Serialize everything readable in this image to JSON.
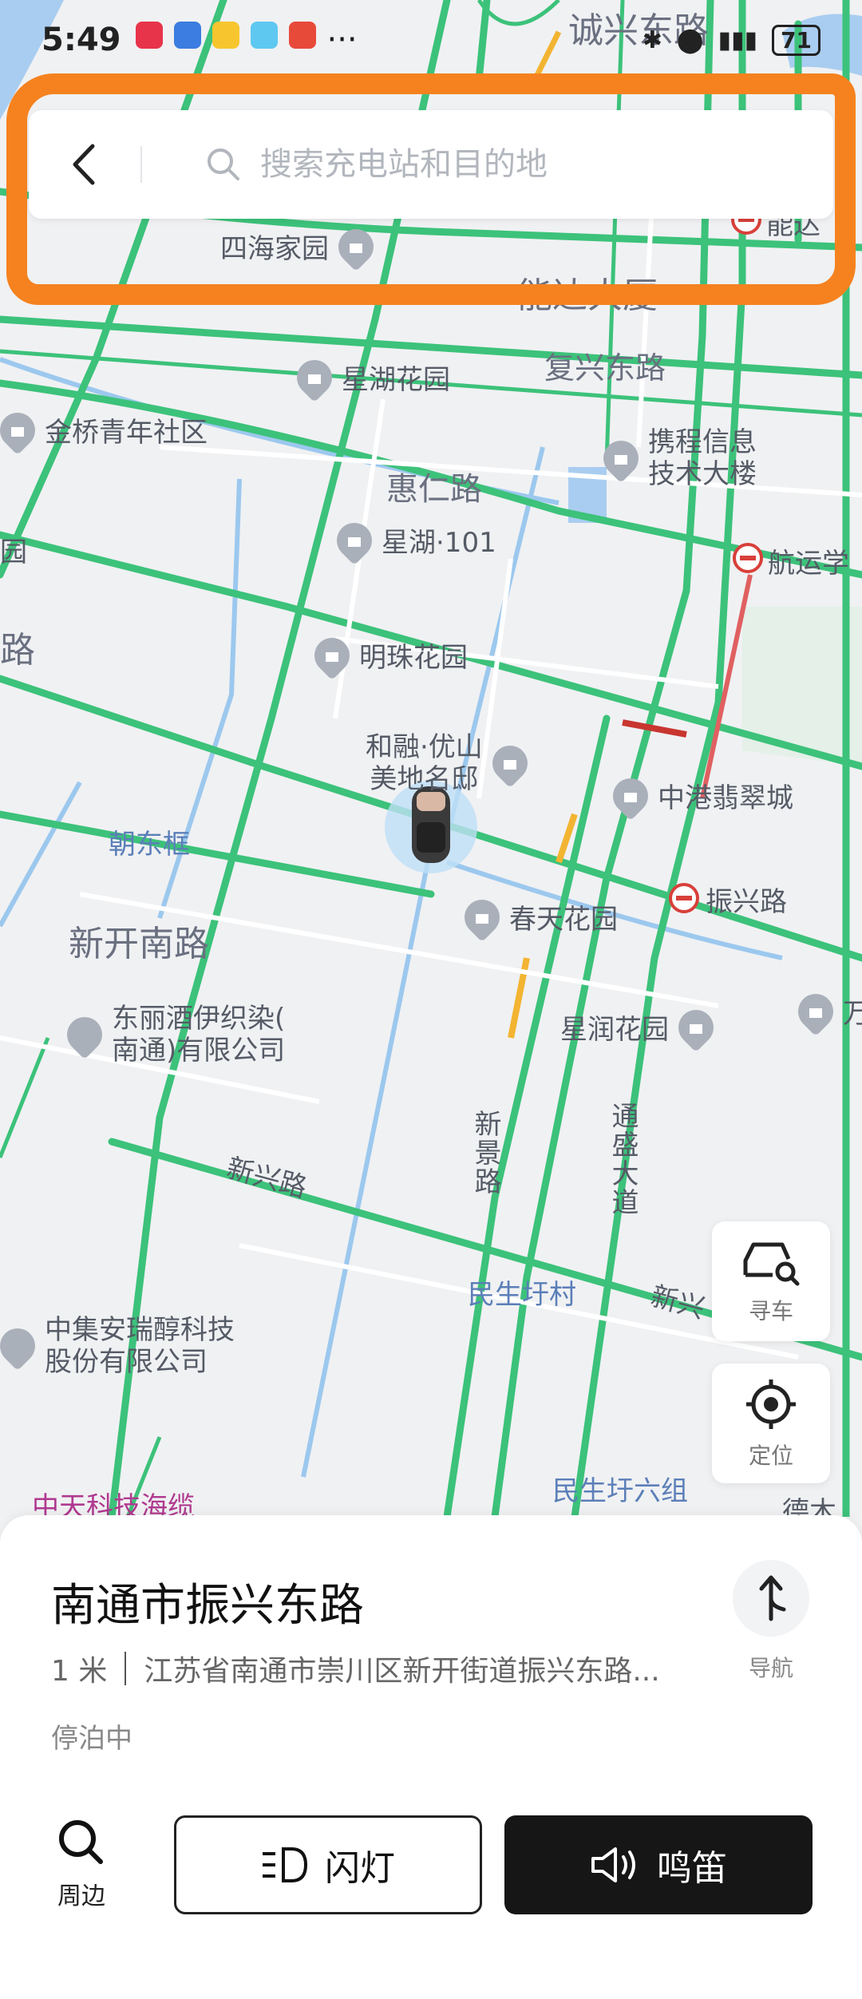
{
  "status_bar": {
    "time": "5:49",
    "battery": "71",
    "carrier_icons": "···"
  },
  "search": {
    "placeholder": "搜索充电站和目的地"
  },
  "map": {
    "labels": {
      "chengxing_road": "诚兴东路",
      "sihai": "四海家园",
      "nengda_dasha": "能达大厦",
      "nengda_station": "能达",
      "fuxing_road": "复兴东路",
      "xinghu_garden": "星湖花园",
      "jinqiao": "金桥青年社区",
      "xiecheng": "携程信息\n技术大楼",
      "huiren_road": "惠仁路",
      "xinghu101": "星湖·101",
      "hangyun": "航运学",
      "yuan_left": "园",
      "road_left": "路",
      "mingzhu": "明珠花园",
      "herong": "和融·优山\n美地名邸",
      "zhonggang": "中港翡翠城",
      "chaodongkuang": "朝东框",
      "xinkainan": "新开南路",
      "chuntian": "春天花园",
      "zhenxing_station": "振兴路",
      "dongli": "东丽酒伊织染(\n南通)有限公司",
      "xingrun": "星润花园",
      "wan": "万",
      "xinxing_road": "新兴路",
      "xinjing_road": "新景路",
      "tongsheng": "通盛大道",
      "minsheng_village": "民生圩村",
      "xinxing_right": "新兴",
      "zhongji": "中集安瑞醇科技\n股份有限公司",
      "minsheng_six": "民生圩六组",
      "zhongtian": "中天科技海缆",
      "de": "德木"
    }
  },
  "fabs": {
    "find_car": "寻车",
    "locate": "定位"
  },
  "place": {
    "title": "南通市振兴东路",
    "distance": "1 米",
    "address": "江苏省南通市崇川区新开街道振兴东路...",
    "status": "停泊中"
  },
  "nav_label": "导航",
  "actions": {
    "nearby": "周边",
    "flash": "闪灯",
    "horn": "鸣笛"
  },
  "colors": {
    "road_green": "#3cc27a",
    "annotation_orange": "#f5821f",
    "primary_dark": "#161616"
  }
}
